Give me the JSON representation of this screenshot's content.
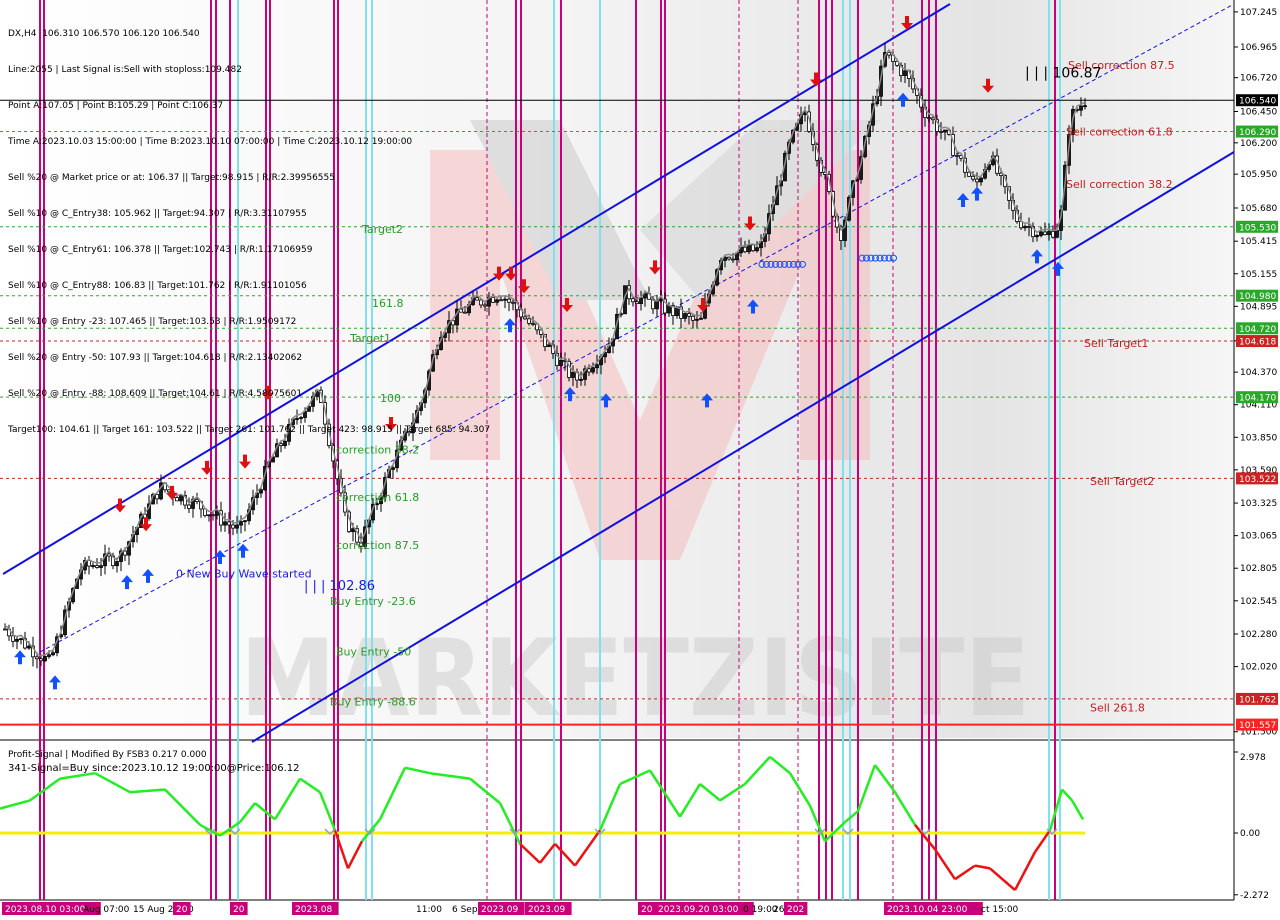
{
  "header": {
    "symbol": "DX,H4",
    "ohlc": "106.310 106.570 106.120 106.540",
    "lines": [
      "Line:2055 | Last Signal is:Sell with stoploss:109.482",
      "Point A:107.05 | Point B:105.29 | Point C:106.37",
      "Time A:2023.10.03 15:00:00 | Time B:2023.10.10 07:00:00 | Time C:2023.10.12 19:00:00",
      "Sell %20 @ Market price or at: 106.37 || Target:98.915 | R/R:2.39956555",
      "Sell %10 @ C_Entry38: 105.962 || Target:94.307 | R/R:3.31107955",
      "Sell %10 @ C_Entry61: 106.378 || Target:102.743 | R/R:1.17106959",
      "Sell %10 @ C_Entry88: 106.83 || Target:101.762 | R/R:1.91101056",
      "Sell %10 @ Entry -23: 107.465 || Target:103.53 | R/R:1.9509172",
      "Sell %20 @ Entry -50: 107.93 || Target:104.618 | R/R:2.13402062",
      "Sell %20 @ Entry -88: 108.609 || Target:104.61 | R/R:4.58075601",
      "Target100: 104.61 || Target 161: 103.522 || Target 261: 101.762 || Target 423: 98.915 || Target 685: 94.307"
    ]
  },
  "price_axis": {
    "ticks": [
      "107.245",
      "106.965",
      "106.720",
      "106.450",
      "106.200",
      "105.950",
      "105.680",
      "105.415",
      "105.155",
      "104.895",
      "104.620",
      "104.370",
      "104.110",
      "103.850",
      "103.590",
      "103.325",
      "103.065",
      "102.805",
      "102.545",
      "102.280",
      "102.020",
      "101.500"
    ],
    "tags": [
      {
        "label": "106.540",
        "color": "#000000"
      },
      {
        "label": "106.290",
        "color": "#2aa82a"
      },
      {
        "label": "105.530",
        "color": "#2aa82a"
      },
      {
        "label": "104.980",
        "color": "#2aa82a"
      },
      {
        "label": "104.720",
        "color": "#2aa82a"
      },
      {
        "label": "104.618",
        "color": "#cc2222"
      },
      {
        "label": "104.170",
        "color": "#2aa82a"
      },
      {
        "label": "103.522",
        "color": "#cc2222"
      },
      {
        "label": "101.762",
        "color": "#cc2222"
      },
      {
        "label": "101.557",
        "color": "#ff2222"
      }
    ]
  },
  "chart_labels": {
    "green": [
      {
        "text": "Target2",
        "price": 105.48
      },
      {
        "text": "161.8",
        "price": 104.89
      },
      {
        "text": "Target1",
        "price": 104.61
      },
      {
        "text": "100",
        "price": 104.13
      },
      {
        "text": "correction 38.2",
        "price": 103.72
      },
      {
        "text": "correction 61.8",
        "price": 103.34
      },
      {
        "text": "correction 87.5",
        "price": 102.96
      },
      {
        "text": "Buy Entry -23.6",
        "price": 102.51
      },
      {
        "text": "Buy Entry -50",
        "price": 102.11
      },
      {
        "text": "Buy Entry -88.6",
        "price": 101.71
      }
    ],
    "red": [
      {
        "text": "Sell correction 87.5",
        "price": 106.79
      },
      {
        "text": "Sell correction 61.8",
        "price": 106.26
      },
      {
        "text": "Sell correction 38.2",
        "price": 105.84
      },
      {
        "text": "Sell Target1",
        "price": 104.57
      },
      {
        "text": "Sell Target2",
        "price": 103.47
      },
      {
        "text": "Sell  261.8",
        "price": 101.66
      }
    ],
    "blue": [
      {
        "text": "0 New Buy Wave started",
        "price": 102.73
      },
      {
        "text": "| | | 102.86",
        "price": 102.63
      }
    ],
    "black": [
      {
        "text": "| | | 106.87",
        "price": 106.72
      }
    ]
  },
  "indicator": {
    "title": "Profit-Signal | Modified By FSB3 0.217 0.000",
    "signal": "341-Signal=Buy since:2023.10.12 19:00:00@Price:106.12",
    "axis_ticks": [
      "2.978",
      "0.00",
      "-2.272"
    ]
  },
  "time_axis": {
    "labels": [
      {
        "text": "2023.08.10 03:00",
        "hl": true
      },
      {
        "text": "Aug 07:00",
        "hl": false
      },
      {
        "text": "15 Aug 23:00",
        "hl": false
      },
      {
        "text": "20",
        "hl": true
      },
      {
        "text": "20",
        "hl": true
      },
      {
        "text": "2023.08",
        "hl": true
      },
      {
        "text": "11:00",
        "hl": false
      },
      {
        "text": "6 Sep",
        "hl": false
      },
      {
        "text": "2023.09",
        "hl": true
      },
      {
        "text": "2023.09",
        "hl": true
      },
      {
        "text": "20",
        "hl": true
      },
      {
        "text": "2023.09.20 03:00",
        "hl": true
      },
      {
        "text": "0 19:00",
        "hl": false
      },
      {
        "text": "26",
        "hl": false
      },
      {
        "text": "202",
        "hl": true
      },
      {
        "text": "2023.10.04 23:00",
        "hl": true
      },
      {
        "text": "ct 15:00",
        "hl": false
      }
    ]
  },
  "colors": {
    "bull_channel": "#1010e0",
    "fib_green": "#2a9a2a",
    "fib_red": "#c02020",
    "magenta_line": "#c8007a",
    "cyan_line": "#80e0f0",
    "buy_arrow": "#1050ff",
    "sell_arrow": "#e01010",
    "osc_up": "#22ee22",
    "osc_down": "#ee1111",
    "zero_line": "#f0f000"
  },
  "watermark": "MARKETZISITE"
}
